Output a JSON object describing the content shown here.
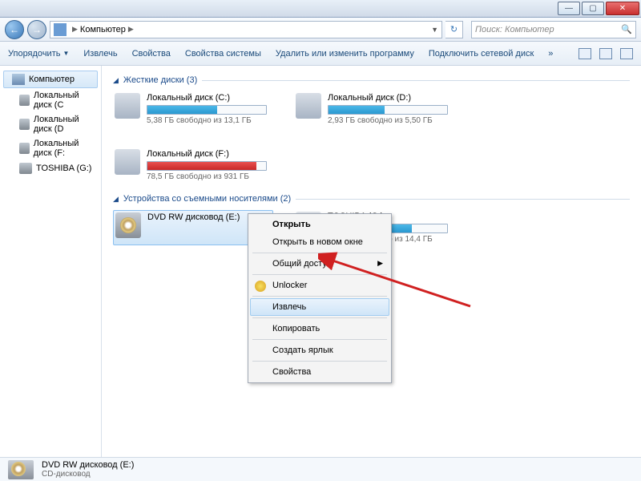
{
  "titlebar": {
    "min": "—",
    "max": "▢",
    "close": "✕"
  },
  "nav": {
    "back": "←",
    "fwd": "→",
    "computer": "Компьютер",
    "refresh": "↻"
  },
  "search": {
    "placeholder": "Поиск: Компьютер",
    "icon": "🔍"
  },
  "toolbar": {
    "organize": "Упорядочить",
    "eject": "Извлечь",
    "props": "Свойства",
    "sysprops": "Свойства системы",
    "uninstall": "Удалить или изменить программу",
    "netdrive": "Подключить сетевой диск",
    "more": "»"
  },
  "sidebar": {
    "computer": "Компьютер",
    "items": [
      {
        "label": "Локальный диск (C"
      },
      {
        "label": "Локальный диск (D"
      },
      {
        "label": "Локальный диск (F:"
      },
      {
        "label": "TOSHIBA (G:)"
      }
    ]
  },
  "groups": {
    "hdd": {
      "title": "Жесткие диски (3)"
    },
    "removable": {
      "title": "Устройства со съемными носителями (2)"
    }
  },
  "drives": {
    "c": {
      "name": "Локальный диск (C:)",
      "free": "5,38 ГБ свободно из 13,1 ГБ",
      "fill": 59
    },
    "d": {
      "name": "Локальный диск (D:)",
      "free": "2,93 ГБ свободно из 5,50 ГБ",
      "fill": 47
    },
    "f": {
      "name": "Локальный диск (F:)",
      "free": "78,5 ГБ свободно из 931 ГБ",
      "fill": 92
    },
    "e": {
      "name": "DVD RW дисковод (E:)"
    },
    "g": {
      "name": "TOSHIBA (G:)",
      "free": "4,31 ГБ свободно из 14,4 ГБ",
      "fill": 70
    }
  },
  "ctx": {
    "open": "Открыть",
    "opennew": "Открыть в новом окне",
    "share": "Общий доступ",
    "unlocker": "Unlocker",
    "eject": "Извлечь",
    "copy": "Копировать",
    "shortcut": "Создать ярлык",
    "props": "Свойства"
  },
  "status": {
    "name": "DVD RW дисковод (E:)",
    "type": "CD-дисковод"
  }
}
